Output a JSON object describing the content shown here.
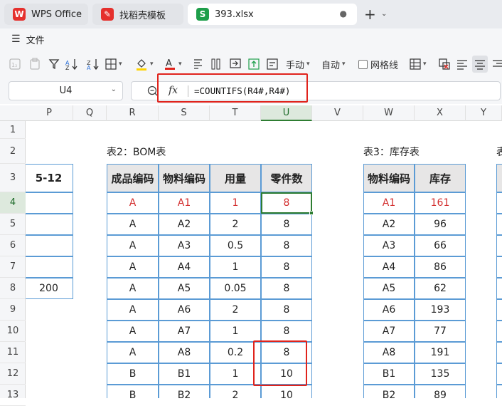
{
  "tabs": [
    {
      "label": "WPS Office",
      "icon": "wps-logo-icon",
      "color": "#e5302d"
    },
    {
      "label": "找稻壳模板",
      "icon": "docer-logo-icon",
      "color": "#e5302d"
    },
    {
      "label": "393.xlsx",
      "icon": "spreadsheet-s-icon",
      "color": "#1e9e4a",
      "active": true
    }
  ],
  "menu": {
    "file_label": "文件"
  },
  "toolbar": {
    "wrap_label": "手动",
    "auto_label": "自动",
    "gridlines_label": "网格线"
  },
  "formula_bar": {
    "name_box": "U4",
    "fx_label": "fx",
    "formula": "=COUNTIFS(R4#,R4#)"
  },
  "columns": [
    "P",
    "Q",
    "R",
    "S",
    "T",
    "U",
    "V",
    "W",
    "X",
    "Y"
  ],
  "selected_column": "U",
  "rows": [
    "1",
    "2",
    "3",
    "4",
    "5",
    "6",
    "7",
    "8",
    "9",
    "10",
    "11",
    "12",
    "13"
  ],
  "selected_row": "4",
  "left_table": {
    "header": "5-12",
    "values": [
      "",
      "",
      "",
      "",
      "200"
    ]
  },
  "bom": {
    "title": "表2：BOM表",
    "headers": [
      "成品编码",
      "物料编码",
      "用量",
      "零件数"
    ],
    "rows": [
      [
        "A",
        "A1",
        "1",
        "8"
      ],
      [
        "A",
        "A2",
        "2",
        "8"
      ],
      [
        "A",
        "A3",
        "0.5",
        "8"
      ],
      [
        "A",
        "A4",
        "1",
        "8"
      ],
      [
        "A",
        "A5",
        "0.05",
        "8"
      ],
      [
        "A",
        "A6",
        "2",
        "8"
      ],
      [
        "A",
        "A7",
        "1",
        "8"
      ],
      [
        "A",
        "A8",
        "0.2",
        "8"
      ],
      [
        "B",
        "B1",
        "1",
        "10"
      ],
      [
        "B",
        "B2",
        "2",
        "10"
      ]
    ]
  },
  "inventory": {
    "title": "表3：库存表",
    "headers": [
      "物料编码",
      "库存"
    ],
    "rows": [
      [
        "A1",
        "161"
      ],
      [
        "A2",
        "96"
      ],
      [
        "A3",
        "66"
      ],
      [
        "A4",
        "86"
      ],
      [
        "A5",
        "62"
      ],
      [
        "A6",
        "193"
      ],
      [
        "A7",
        "77"
      ],
      [
        "A8",
        "191"
      ],
      [
        "B1",
        "135"
      ],
      [
        "B2",
        "89"
      ]
    ]
  },
  "partial_title": "表",
  "colors": {
    "accent_red": "#e0231c",
    "selection_green": "#2e7d32",
    "table_border": "#5b9bd5"
  }
}
